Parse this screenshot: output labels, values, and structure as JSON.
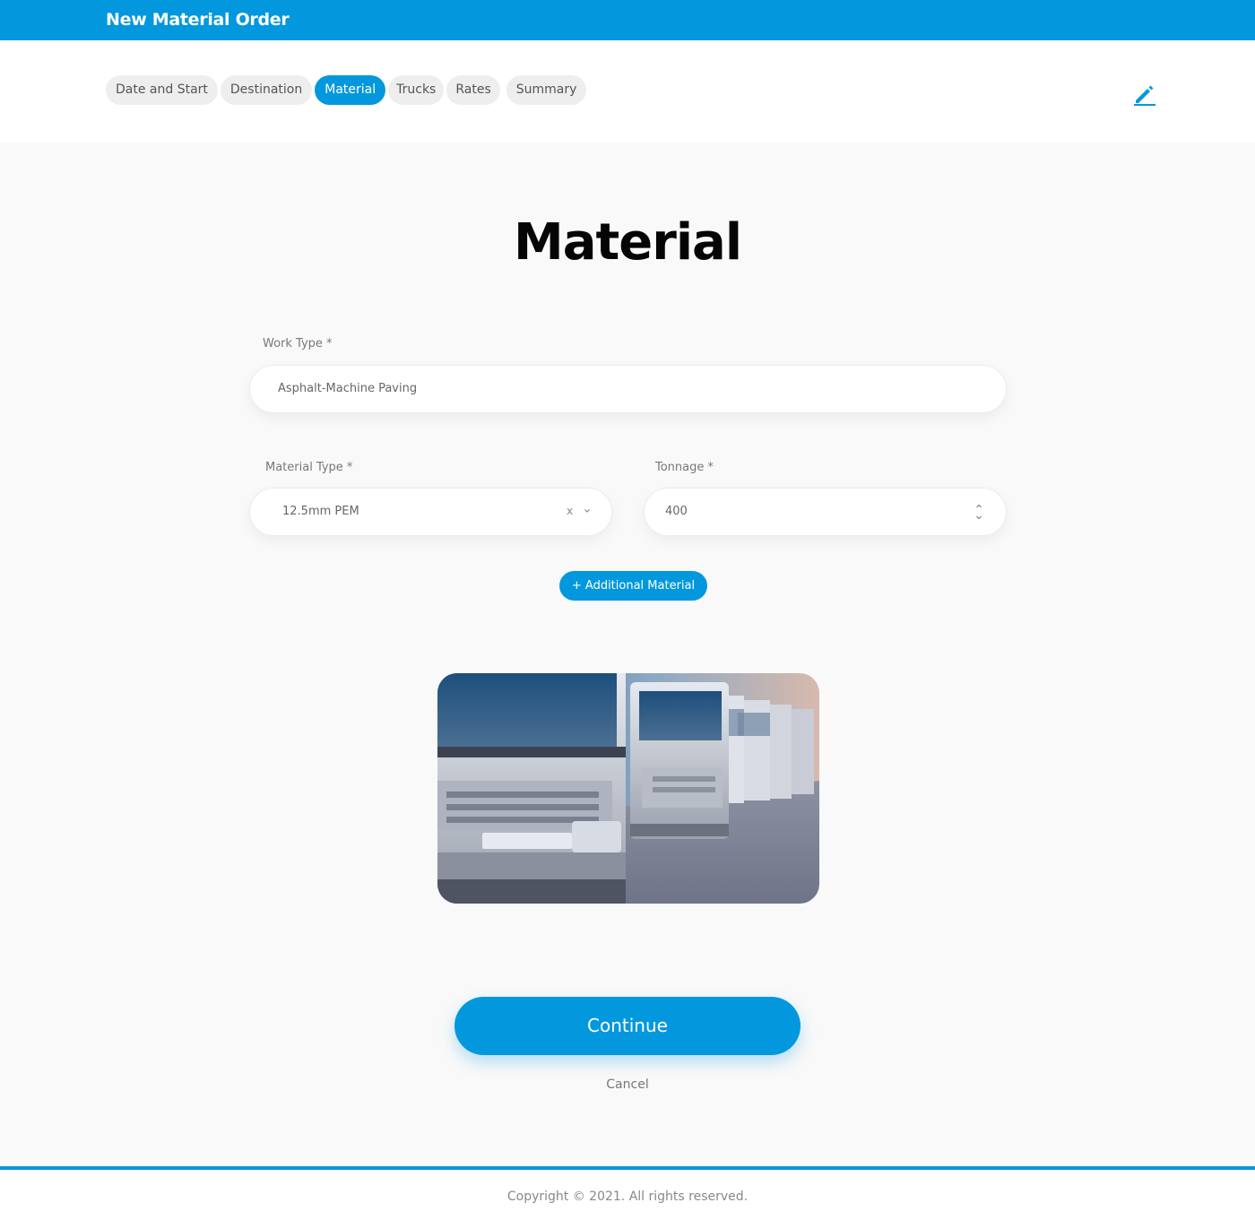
{
  "app": {
    "title": "New Material Order"
  },
  "steps": [
    {
      "label": "Date and Start"
    },
    {
      "label": "Destination"
    },
    {
      "label": "Material",
      "active": true
    },
    {
      "label": "Trucks"
    },
    {
      "label": "Rates"
    },
    {
      "label": "Summary"
    }
  ],
  "header_icon": "edit-pencil-icon",
  "page": {
    "title": "Material"
  },
  "form": {
    "work_type": {
      "label": "Work Type *",
      "value": "Asphalt-Machine Paving"
    },
    "material_type": {
      "label": "Material Type *",
      "value": "12.5mm PEM",
      "clear": "x"
    },
    "tonnage": {
      "label": "Tonnage *",
      "value": "400"
    }
  },
  "add_material": {
    "label": "+ Additional Material"
  },
  "image": {
    "subject": "row of parked trucks"
  },
  "continue": {
    "label": "Continue"
  },
  "cancel": {
    "label": "Cancel"
  },
  "footer": {
    "copyright": "Copyright © 2021. All rights reserved."
  },
  "colors": {
    "primary": "#0398dd",
    "background": "#f9f9f9",
    "step_bg": "#eeeeee"
  }
}
